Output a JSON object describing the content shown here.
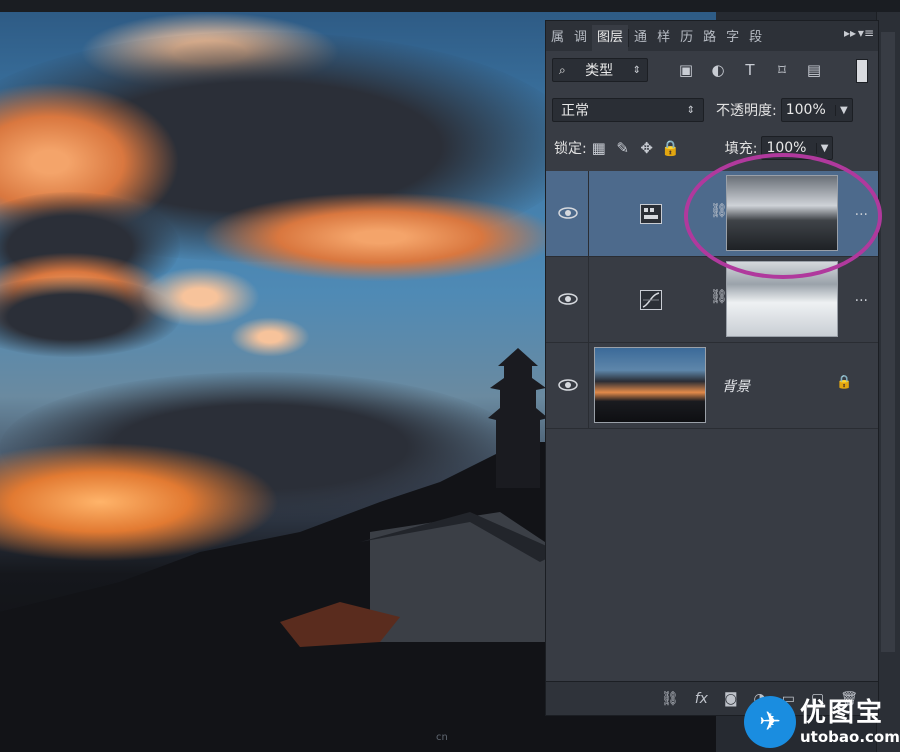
{
  "panel": {
    "tabs": [
      "属",
      "调",
      "图层",
      "通",
      "样",
      "历",
      "路",
      "字",
      "段"
    ],
    "active_tab": "图层",
    "collapse_icon": "double-chevron-right-icon",
    "menu_icon": "panel-menu-icon"
  },
  "filter": {
    "kind_label": "类型",
    "icons": [
      "image-filter-icon",
      "adjustment-filter-icon",
      "text-filter-icon",
      "shape-filter-icon",
      "smart-object-filter-icon"
    ]
  },
  "blend": {
    "mode": "正常",
    "opacity_label": "不透明度:",
    "opacity_value": "100%"
  },
  "lock": {
    "label": "锁定:",
    "fill_label": "填充:",
    "fill_value": "100%"
  },
  "layers": [
    {
      "type": "adjustment",
      "icon": "levels-adjustment-icon",
      "selected": true,
      "name": ""
    },
    {
      "type": "adjustment",
      "icon": "curves-adjustment-icon",
      "selected": false,
      "name": ""
    },
    {
      "type": "image",
      "icon": "background-thumbnail",
      "selected": false,
      "name": "背景",
      "locked": true
    }
  ],
  "bottom_icons": [
    "link-layers-icon",
    "fx-icon",
    "add-mask-icon",
    "new-fill-adjustment-icon",
    "new-group-icon",
    "new-layer-icon",
    "delete-layer-icon"
  ],
  "bottom_fx_label": "fx",
  "highlight_color": "#b0399d",
  "watermark": {
    "cn": "优图宝",
    "en": "utobao.com"
  },
  "small_watermark": "cn"
}
